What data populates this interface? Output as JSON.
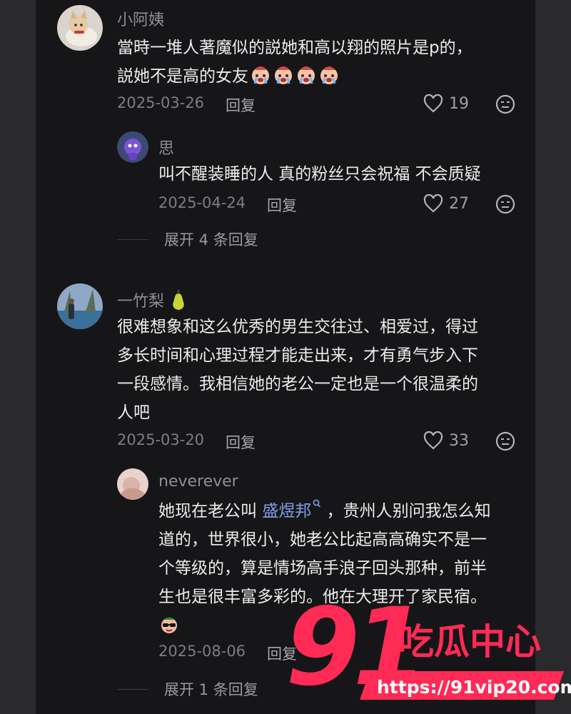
{
  "comments": [
    {
      "username": "小阿姨",
      "lines": [
        "當時一堆人著魔似的説她和高以翔的照片是p的，",
        "説她不是高的女友"
      ],
      "date": "2025-03-26",
      "reply_label": "回复",
      "likes": "19"
    },
    {
      "username": "一竹梨",
      "lines": [
        "很难想象和这么优秀的男生交往过、相爱过，得过",
        "多长时间和心理过程才能走出来，才有勇气步入下",
        "一段感情。我相信她的老公一定也是一个很温柔的",
        "人吧"
      ],
      "date": "2025-03-20",
      "reply_label": "回复",
      "likes": "33"
    }
  ],
  "replies": [
    {
      "username": "思",
      "text": "叫不醒装睡的人 真的粉丝只会祝福 不会质疑",
      "date": "2025-04-24",
      "reply_label": "回复",
      "likes": "27"
    },
    {
      "username": "neverever",
      "line1_prefix": "她现在老公叫 ",
      "mention": "盛煜邦",
      "line1_suffix": " ，贵州人别问我怎么知",
      "lines": [
        "道的，世界很小，她老公比起高高确实不是一",
        "个等级的，算是情场高手浪子回头那种，前半",
        "生也是很丰富多彩的。他在大理开了家民宿。"
      ],
      "date": "2025-08-06",
      "reply_label": "回复"
    }
  ],
  "expand": [
    "展开 4 条回复",
    "展开 1 条回复"
  ],
  "watermark": {
    "number": "91",
    "brand": "吃瓜中心",
    "url": "https://91vip20.com"
  },
  "colors": {
    "background": "#161618",
    "mention": "#7ea0e6",
    "watermark_red": "#ff2a55"
  },
  "icons": [
    "heart-icon",
    "dislike-face-icon",
    "crying-emoji",
    "cool-emoji",
    "pear-emoji",
    "search-icon"
  ]
}
